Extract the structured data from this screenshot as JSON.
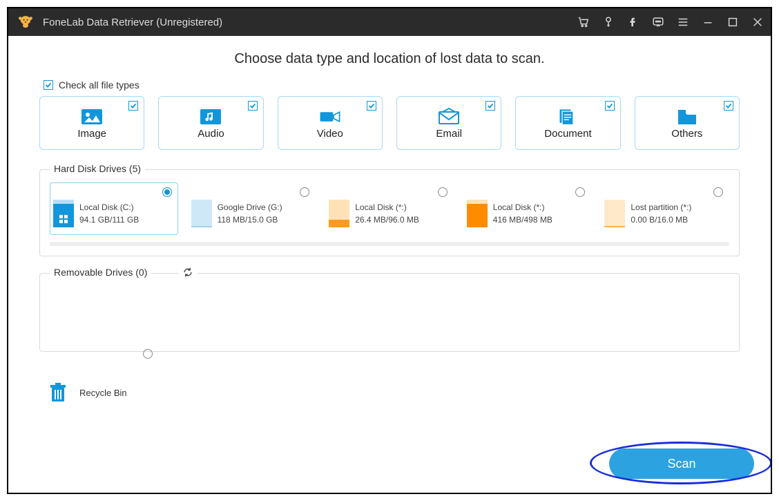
{
  "titlebar": {
    "app_title": "FoneLab Data Retriever (Unregistered)"
  },
  "heading": "Choose data type and location of lost data to scan.",
  "check_all_label": "Check all file types",
  "types": {
    "image": "Image",
    "audio": "Audio",
    "video": "Video",
    "email": "Email",
    "document": "Document",
    "others": "Others"
  },
  "sections": {
    "hdd_legend": "Hard Disk Drives (5)",
    "removable_legend": "Removable Drives (0)"
  },
  "drives": [
    {
      "name": "Local Disk (C:)",
      "size": "94.1 GB/111 GB",
      "color_bg": "#b7ddf5",
      "color_fill": "#1296db",
      "fill_ratio": 0.85,
      "selected": true,
      "win": true
    },
    {
      "name": "Google Drive (G:)",
      "size": "118 MB/15.0 GB",
      "color_bg": "#cfe8f7",
      "color_fill": "#9ed2ef",
      "fill_ratio": 0.02,
      "selected": false
    },
    {
      "name": "Local Disk (*:)",
      "size": "26.4 MB/96.0 MB",
      "color_bg": "#ffe1b8",
      "color_fill": "#ff9a1f",
      "fill_ratio": 0.28,
      "selected": false
    },
    {
      "name": "Local Disk (*:)",
      "size": "416 MB/498 MB",
      "color_bg": "#ffe1b8",
      "color_fill": "#ff8c00",
      "fill_ratio": 0.84,
      "selected": false
    },
    {
      "name": "Lost partition (*:)",
      "size": "0.00  B/16.0 MB",
      "color_bg": "#ffe9c9",
      "color_fill": "#ffb24d",
      "fill_ratio": 0.0,
      "selected": false
    }
  ],
  "recycle_label": "Recycle Bin",
  "scan_label": "Scan"
}
